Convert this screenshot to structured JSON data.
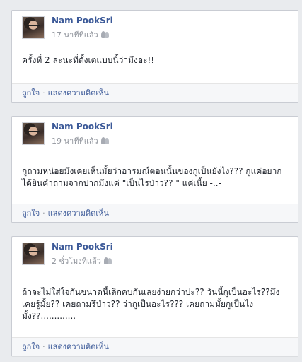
{
  "posts": [
    {
      "author": "Nam PookSri",
      "time": "17 นาทีที่แล้ว",
      "text": "ครั้งที่ 2 ละนะที่ตั้งเตแบบนี้ว่ามึงอะ!!",
      "like_label": "ถูกใจ",
      "separator": "·",
      "comment_label": "แสดงความคิดเห็น"
    },
    {
      "author": "Nam PookSri",
      "time": "19 นาทีที่แล้ว",
      "text": "กูถามหน่อยมึงเคยเห็นมั้ยว่าอารมณ์ตอนนั้นของกูเป็นยังไง??? กูแค่อยากได้ยินคำถามจากปากมึงแค่ \"เป็นไรป่าว?? \" แค่เนี้ย -..-",
      "like_label": "ถูกใจ",
      "separator": "·",
      "comment_label": "แสดงความคิดเห็น"
    },
    {
      "author": "Nam PookSri",
      "time": "2 ชั่วโมงที่แล้ว",
      "text": "ถ้าจะไม่ใส่ใจกันขนาดนี้เลิกคบกันเลยง่ายกว่าปะ?? วันนี้กูเป็นอะไร??มึงเคยรู้มั้ย?? เคยถามรึป่าว?? ว่ากูเป็นอะไร??? เคยถามมั้ยกูเป็นไงมั้ง??.............",
      "like_label": "ถูกใจ",
      "separator": "·",
      "comment_label": "แสดงความคิดเห็น"
    }
  ],
  "icons": {
    "avatar": "profile-photo",
    "audience": "friends-icon"
  },
  "colors": {
    "link": "#3b5998",
    "meta": "#90949c",
    "text": "#1d2129",
    "background": "#e9ebee"
  }
}
